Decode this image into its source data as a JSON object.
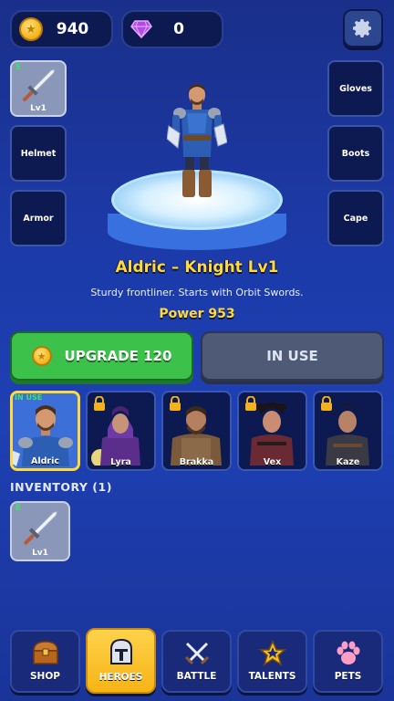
{
  "currency": {
    "coins": "940",
    "gems": "0"
  },
  "slots": {
    "weapon": {
      "tag": "E",
      "level": "Lv1"
    },
    "helmet": "Helmet",
    "armor": "Armor",
    "gloves": "Gloves",
    "boots": "Boots",
    "cape": "Cape"
  },
  "hero": {
    "title": "Aldric – Knight  Lv1",
    "description": "Sturdy frontliner. Starts with Orbit Swords.",
    "power": "Power 953"
  },
  "actions": {
    "upgrade": "UPGRADE 120",
    "in_use": "IN USE"
  },
  "roster": [
    {
      "name": "Aldric",
      "status": "IN USE",
      "locked": false
    },
    {
      "name": "Lyra",
      "locked": true
    },
    {
      "name": "Brakka",
      "locked": true
    },
    {
      "name": "Vex",
      "locked": true
    },
    {
      "name": "Kaze",
      "locked": true
    }
  ],
  "inventory": {
    "title": "INVENTORY (1)",
    "items": [
      {
        "tag": "E",
        "level": "Lv1",
        "icon": "sword-icon"
      }
    ]
  },
  "nav": [
    {
      "label": "SHOP",
      "icon": "chest-icon"
    },
    {
      "label": "HEROES",
      "icon": "helmet-icon",
      "active": true
    },
    {
      "label": "BATTLE",
      "icon": "crossed-swords-icon"
    },
    {
      "label": "TALENTS",
      "icon": "star-icon"
    },
    {
      "label": "PETS",
      "icon": "paw-icon"
    }
  ]
}
